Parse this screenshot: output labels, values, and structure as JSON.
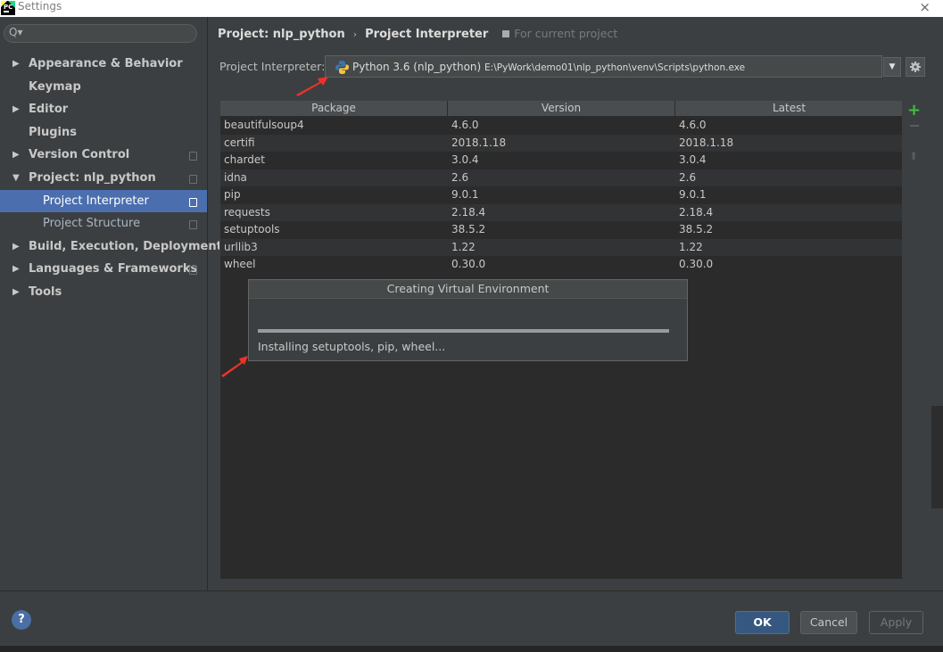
{
  "window": {
    "title": "Settings",
    "close": "×"
  },
  "sidebar": {
    "search_icon": "Q▾",
    "items": [
      {
        "label": "Appearance & Behavior",
        "arrow": "▶",
        "child": false,
        "selected": false,
        "copy": false
      },
      {
        "label": "Keymap",
        "arrow": "",
        "child": false,
        "selected": false,
        "copy": false
      },
      {
        "label": "Editor",
        "arrow": "▶",
        "child": false,
        "selected": false,
        "copy": false
      },
      {
        "label": "Plugins",
        "arrow": "",
        "child": false,
        "selected": false,
        "copy": false
      },
      {
        "label": "Version Control",
        "arrow": "▶",
        "child": false,
        "selected": false,
        "copy": true
      },
      {
        "label": "Project: nlp_python",
        "arrow": "▼",
        "child": false,
        "selected": false,
        "copy": true
      },
      {
        "label": "Project Interpreter",
        "arrow": "",
        "child": true,
        "selected": true,
        "copy": true
      },
      {
        "label": "Project Structure",
        "arrow": "",
        "child": true,
        "selected": false,
        "copy": true
      },
      {
        "label": "Build, Execution, Deployment",
        "arrow": "▶",
        "child": false,
        "selected": false,
        "copy": false
      },
      {
        "label": "Languages & Frameworks",
        "arrow": "▶",
        "child": false,
        "selected": false,
        "copy": true
      },
      {
        "label": "Tools",
        "arrow": "▶",
        "child": false,
        "selected": false,
        "copy": false
      }
    ]
  },
  "breadcrumb": {
    "project": "Project: nlp_python",
    "separator": "›",
    "page": "Project Interpreter",
    "scope": "For current project"
  },
  "interpreter": {
    "label": "Project Interpreter:",
    "name": "Python 3.6 (nlp_python)",
    "path": "E:\\PyWork\\demo01\\nlp_python\\venv\\Scripts\\python.exe",
    "dropdown_icon": "▼"
  },
  "packages": {
    "headers": [
      "Package",
      "Version",
      "Latest"
    ],
    "rows": [
      [
        "beautifulsoup4",
        "4.6.0",
        "4.6.0"
      ],
      [
        "certifi",
        "2018.1.18",
        "2018.1.18"
      ],
      [
        "chardet",
        "3.0.4",
        "3.0.4"
      ],
      [
        "idna",
        "2.6",
        "2.6"
      ],
      [
        "pip",
        "9.0.1",
        "9.0.1"
      ],
      [
        "requests",
        "2.18.4",
        "2.18.4"
      ],
      [
        "setuptools",
        "38.5.2",
        "38.5.2"
      ],
      [
        "urllib3",
        "1.22",
        "1.22"
      ],
      [
        "wheel",
        "0.30.0",
        "0.30.0"
      ]
    ],
    "add_icon": "+",
    "upgrade_icon": "⬆"
  },
  "progress_dialog": {
    "title": "Creating Virtual Environment",
    "status": "Installing setuptools, pip, wheel...",
    "progress": 1.0
  },
  "footer": {
    "help": "?",
    "ok": "OK",
    "cancel": "Cancel",
    "apply": "Apply"
  },
  "colors": {
    "background": "#3c3f41",
    "selection": "#4b6eaf",
    "ok_button": "#365880",
    "annotation_arrow": "#e8332a",
    "add_green": "#3fbf3f"
  }
}
